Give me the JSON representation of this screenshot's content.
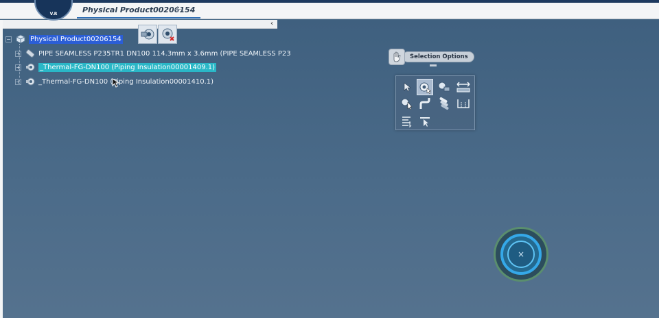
{
  "app": {
    "logo_text": "V.R"
  },
  "tabs": [
    {
      "label": "Physical Product00206154",
      "active": true
    }
  ],
  "tab_add_label": "+",
  "tree": {
    "collapse_label": "‹",
    "root": {
      "label": "Physical Product00206154",
      "selected": true
    },
    "children": [
      {
        "label": "PIPE SEAMLESS P235TR1 DN100 114.3mm x 3.6mm (PIPE SEAMLESS P23",
        "highlighted": false,
        "icon": "pipe-icon"
      },
      {
        "label": "_Thermal-FG-DN100 (Piping Insulation00001409.1)",
        "highlighted": true,
        "icon": "insulation-icon"
      },
      {
        "label": "_Thermal-FG-DN100 (Piping Insulation00001410.1)",
        "highlighted": false,
        "icon": "insulation-icon"
      }
    ]
  },
  "selection_options": {
    "label": "Selection Options",
    "tools": [
      "select-arrow-icon",
      "component-select-icon",
      "part-select-icon",
      "measure-icon",
      "trap-select-icon",
      "pipe-run-icon",
      "stacked-parts-icon",
      "bracket-icon",
      "list-select-icon",
      "pointer-filter-icon"
    ]
  },
  "compass": {
    "center_label": "×"
  },
  "colors": {
    "viewport": "#4a6a87",
    "root_selection": "#2b5ed6",
    "highlight": "#2ab7c7",
    "compass_ring": "#35a8e8"
  }
}
